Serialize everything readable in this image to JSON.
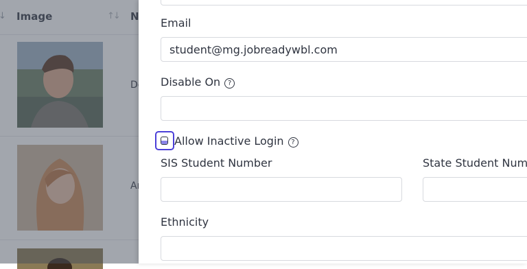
{
  "table": {
    "header_image": "Image",
    "header_name": "Na",
    "rows": [
      {
        "name_fragment": "De"
      },
      {
        "name_fragment": "An"
      },
      {
        "name_fragment": ""
      }
    ]
  },
  "form": {
    "email_label": "Email",
    "email_value": "student@mg.jobreadywbl.com",
    "disable_on_label": "Disable On",
    "disable_on_value": "",
    "allow_inactive_login_label": "Allow Inactive Login",
    "sis_student_number_label": "SIS Student Number",
    "sis_student_number_value": "",
    "state_student_number_label": "State Student Numb",
    "state_student_number_value": "",
    "ethnicity_label": "Ethnicity",
    "ethnicity_value": "",
    "help_glyph": "?"
  },
  "colors": {
    "focus_ring": "#4b3fd8",
    "overlay": "rgba(70,78,92,0.5)"
  },
  "icons": [
    "sort-arrow-icon",
    "sort-icon",
    "help-icon",
    "checkbox-icon"
  ]
}
